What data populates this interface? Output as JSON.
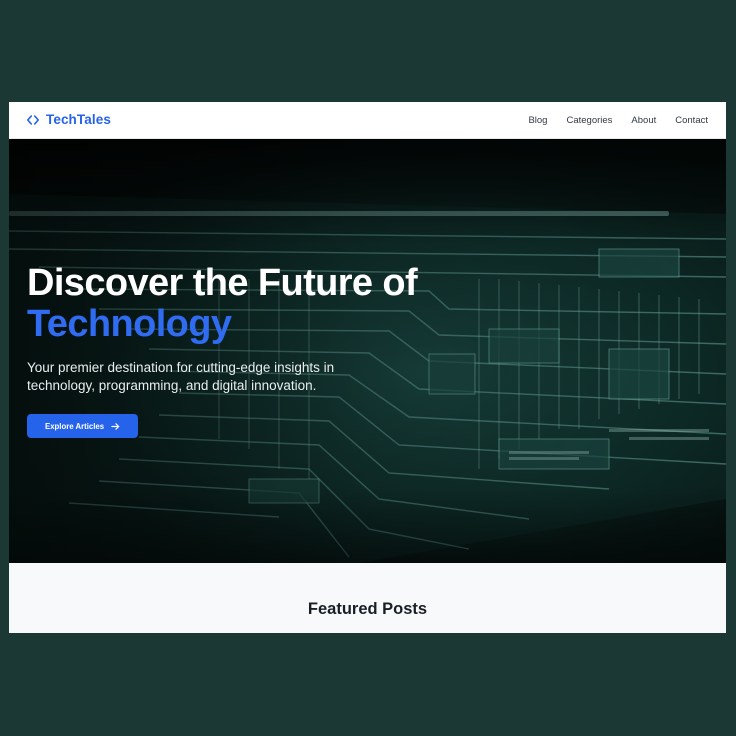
{
  "brand": {
    "name": "TechTales",
    "icon": "code-brackets-icon",
    "color": "#2563eb"
  },
  "nav": {
    "items": [
      {
        "label": "Blog"
      },
      {
        "label": "Categories"
      },
      {
        "label": "About"
      },
      {
        "label": "Contact"
      }
    ]
  },
  "hero": {
    "title_line1": "Discover the Future of",
    "title_line2": "Technology",
    "subtitle": "Your premier destination for cutting-edge insights in technology, programming, and digital innovation.",
    "cta_label": "Explore Articles",
    "cta_icon": "arrow-right-icon",
    "background": "circuit-board-image",
    "accent_color": "#2f6cf2"
  },
  "featured": {
    "title": "Featured Posts"
  },
  "colors": {
    "page_background": "#1b3834",
    "button": "#2563eb"
  }
}
